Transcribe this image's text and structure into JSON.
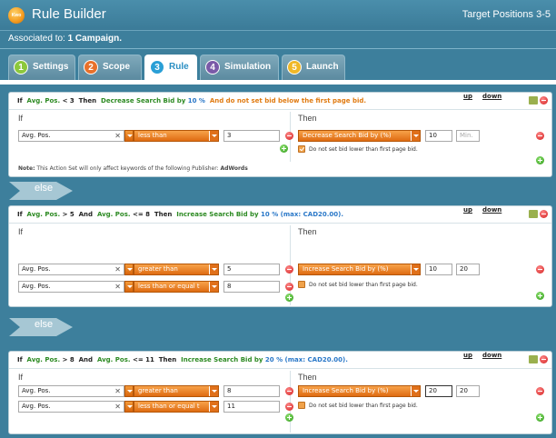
{
  "app": {
    "logo_text": "Kwo",
    "title": "Rule Builder",
    "target_positions": "Target Positions 3-5",
    "associated_prefix": "Associated to:",
    "associated_value": "1 Campaign."
  },
  "tabs": [
    {
      "num": "1",
      "label": "Settings",
      "color": "#8cc83c"
    },
    {
      "num": "2",
      "label": "Scope",
      "color": "#e8702a"
    },
    {
      "num": "3",
      "label": "Rule",
      "color": "#2a9fd6",
      "active": true
    },
    {
      "num": "4",
      "label": "Simulation",
      "color": "#7a5aa8"
    },
    {
      "num": "5",
      "label": "Launch",
      "color": "#f0b828"
    }
  ],
  "common": {
    "if_label": "If",
    "then_label": "Then",
    "up": "up",
    "down": "down",
    "else": "else",
    "min_placeholder": "Min.",
    "checkbox_label": "Do not set bid lower than first page bid.",
    "note_prefix": "Note:",
    "note_text": "This Action Set will only affect keywords of the following Publisher:",
    "note_publisher": "AdWords"
  },
  "rules": [
    {
      "header": {
        "if": "If",
        "metric": "Avg. Pos.",
        "cmp": "< 3",
        "then": "Then",
        "action": "Decrease Search Bid by",
        "amount": "10 %",
        "extra": "And do not set bid below the first page bid."
      },
      "conditions": [
        {
          "metric": "Avg. Pos.",
          "operator": "less than",
          "value": "3"
        }
      ],
      "action": {
        "type": "Decrease Search Bid by (%)",
        "amount": "10",
        "max": "",
        "checked": true
      }
    },
    {
      "header": {
        "if": "If",
        "metric": "Avg. Pos.",
        "cmp": "> 5",
        "and": "And",
        "metric2": "Avg. Pos.",
        "cmp2": "<= 8",
        "then": "Then",
        "action": "Increase Search Bid by",
        "amount": "10 %",
        "max_prefix": "(max:",
        "max_value": "CAD20.00",
        "max_suffix": ")."
      },
      "conditions": [
        {
          "metric": "Avg. Pos.",
          "operator": "greater than",
          "value": "5"
        },
        {
          "metric": "Avg. Pos.",
          "operator": "less than or equal t",
          "value": "8"
        }
      ],
      "action": {
        "type": "Increase Search Bid by (%)",
        "amount": "10",
        "max": "20",
        "checked": false
      }
    },
    {
      "header": {
        "if": "If",
        "metric": "Avg. Pos.",
        "cmp": "> 8",
        "and": "And",
        "metric2": "Avg. Pos.",
        "cmp2": "<= 11",
        "then": "Then",
        "action": "Increase Search Bid by",
        "amount": "20 %",
        "max_prefix": "(max:",
        "max_value": "CAD20.00",
        "max_suffix": ")."
      },
      "conditions": [
        {
          "metric": "Avg. Pos.",
          "operator": "greater than",
          "value": "8"
        },
        {
          "metric": "Avg. Pos.",
          "operator": "less than or equal t",
          "value": "11"
        }
      ],
      "action": {
        "type": "Increase Search Bid by (%)",
        "amount": "20",
        "max": "20",
        "checked": false
      }
    }
  ]
}
